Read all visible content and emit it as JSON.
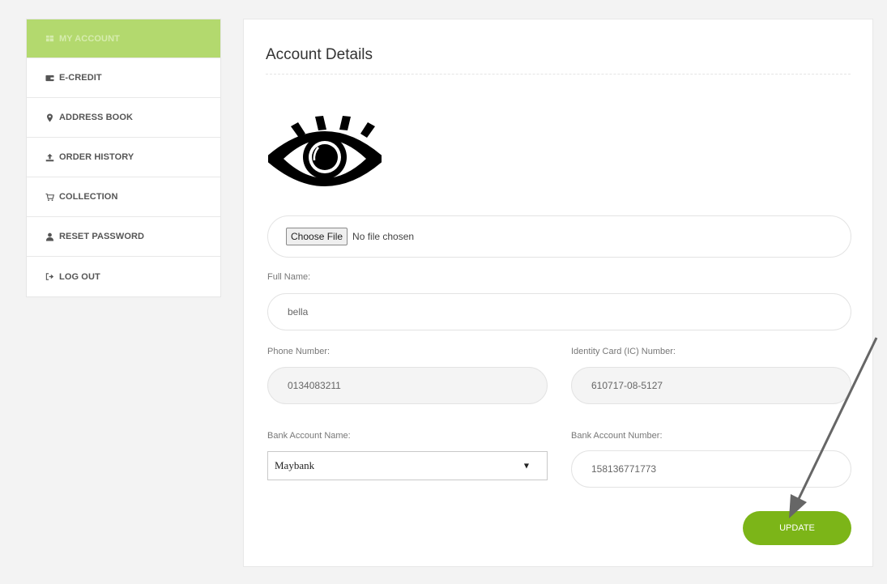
{
  "sidebar": {
    "items": [
      {
        "label": "MY ACCOUNT",
        "icon": "dashboard-icon",
        "active": true
      },
      {
        "label": "E-CREDIT",
        "icon": "wallet-icon"
      },
      {
        "label": "ADDRESS BOOK",
        "icon": "map-marker-icon"
      },
      {
        "label": "ORDER HISTORY",
        "icon": "upload-icon"
      },
      {
        "label": "COLLECTION",
        "icon": "cart-icon"
      },
      {
        "label": "RESET PASSWORD",
        "icon": "user-icon"
      },
      {
        "label": "LOG OUT",
        "icon": "sign-out-icon"
      }
    ]
  },
  "main": {
    "title": "Account Details",
    "avatar_icon": "eye-icon",
    "file_input": {
      "button_label": "Choose File",
      "status": "No file chosen"
    },
    "full_name": {
      "label": "Full Name:",
      "value": "bella"
    },
    "phone": {
      "label": "Phone Number:",
      "value": "0134083211"
    },
    "ic": {
      "label": "Identity Card (IC) Number:",
      "value": "610717-08-5127"
    },
    "bank_name": {
      "label": "Bank Account Name:",
      "value": "Maybank"
    },
    "bank_number": {
      "label": "Bank Account Number:",
      "value": "158136771773"
    },
    "update_label": "UPDATE"
  },
  "colors": {
    "active_tab": "#b3d96e",
    "update_button": "#7cb518",
    "annotation_arrow": "#666666"
  }
}
